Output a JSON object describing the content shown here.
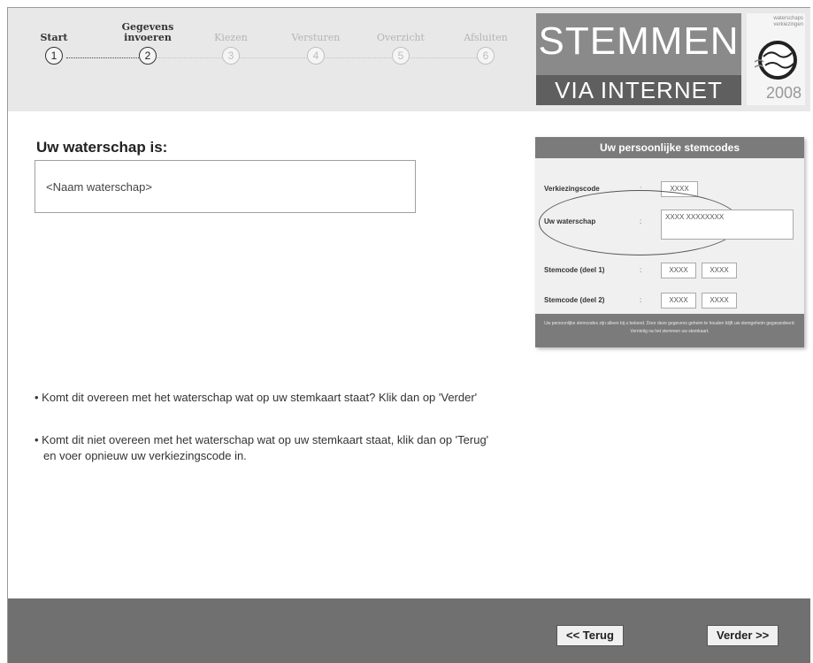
{
  "steps": [
    {
      "label": "Start",
      "number": "1",
      "state": "done"
    },
    {
      "label": "Gegevens invoeren",
      "number": "2",
      "state": "active"
    },
    {
      "label": "Kiezen",
      "number": "3",
      "state": "inactive"
    },
    {
      "label": "Versturen",
      "number": "4",
      "state": "inactive"
    },
    {
      "label": "Overzicht",
      "number": "5",
      "state": "inactive"
    },
    {
      "label": "Afsluiten",
      "number": "6",
      "state": "inactive"
    }
  ],
  "logo": {
    "line1": "STEMMEN",
    "line2": "VIA INTERNET"
  },
  "badge": {
    "text": "waterschaps verkiezingen",
    "year": "2008"
  },
  "main": {
    "title": "Uw waterschap is:",
    "name_value": "<Naam waterschap>",
    "bullets": [
      "• Komt dit overeen met het waterschap wat op uw stemkaart staat? Klik dan op 'Verder'",
      "• Komt dit niet overeen met het waterschap wat op uw stemkaart staat, klik dan op 'Terug'",
      "en voer opnieuw uw verkiezingscode in."
    ]
  },
  "card": {
    "title": "Uw persoonlijke stemcodes",
    "rows": [
      {
        "label": "Verkiezingscode",
        "codes": [
          "XXXX"
        ]
      },
      {
        "label": "Uw waterschap",
        "codes": [
          "XXXX XXXXXXXX"
        ]
      },
      {
        "label": "Stemcode (deel 1)",
        "codes": [
          "XXXX",
          "XXXX"
        ]
      },
      {
        "label": "Stemcode (deel 2)",
        "codes": [
          "XXXX",
          "XXXX"
        ]
      }
    ],
    "colon": ":",
    "footer": "Uw persoonlijke stemcodes zijn alleen bij u bekend. Door deze gegevens geheim te houden blijft uw stemgeheim gegarandeerd. Vernietig na het stemmen uw stemkaart."
  },
  "nav": {
    "back_label": "<<   Terug",
    "next_label": "Verder   >>"
  },
  "colors": {
    "header_bg": "#e8e8e8",
    "logo_bg": "#8a8a8a",
    "footer_bg": "#707070"
  }
}
